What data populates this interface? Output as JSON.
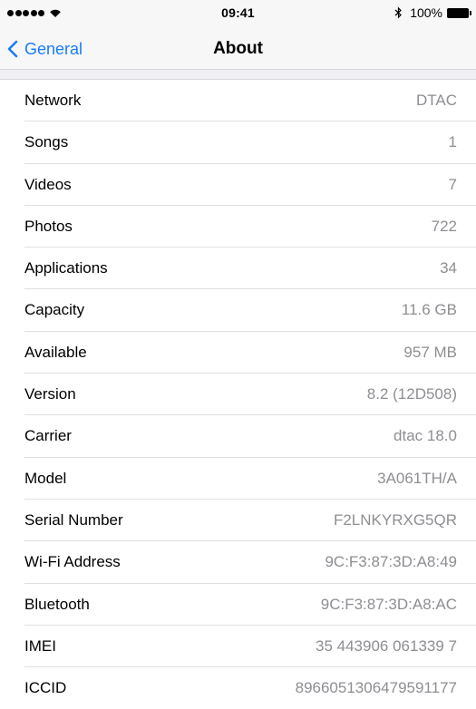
{
  "status_bar": {
    "time": "09:41",
    "battery_percent": "100%",
    "signal_bars": 5
  },
  "nav": {
    "back_label": "General",
    "title": "About"
  },
  "colors": {
    "accent": "#1a7cf8",
    "value_text": "#8e8e93",
    "background": "#efeff4"
  },
  "rows": [
    {
      "label": "Network",
      "value": "DTAC"
    },
    {
      "label": "Songs",
      "value": "1"
    },
    {
      "label": "Videos",
      "value": "7"
    },
    {
      "label": "Photos",
      "value": "722"
    },
    {
      "label": "Applications",
      "value": "34"
    },
    {
      "label": "Capacity",
      "value": "11.6 GB"
    },
    {
      "label": "Available",
      "value": "957 MB"
    },
    {
      "label": "Version",
      "value": "8.2 (12D508)"
    },
    {
      "label": "Carrier",
      "value": "dtac 18.0"
    },
    {
      "label": "Model",
      "value": "3A061TH/A"
    },
    {
      "label": "Serial Number",
      "value": "F2LNKYRXG5QR"
    },
    {
      "label": "Wi-Fi Address",
      "value": "9C:F3:87:3D:A8:49"
    },
    {
      "label": "Bluetooth",
      "value": "9C:F3:87:3D:A8:AC"
    },
    {
      "label": "IMEI",
      "value": "35 443906 061339 7"
    },
    {
      "label": "ICCID",
      "value": "89660513064795911​77"
    }
  ]
}
